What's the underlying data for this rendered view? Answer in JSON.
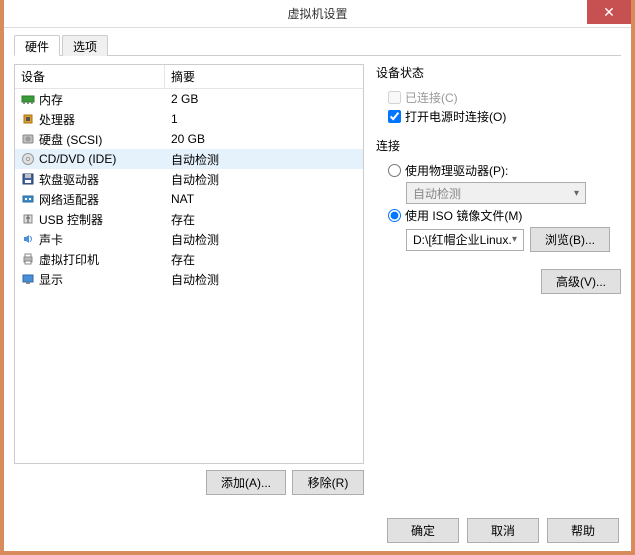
{
  "window": {
    "title": "虚拟机设置",
    "close_glyph": "✕"
  },
  "tabs": {
    "hardware": "硬件",
    "options": "选项"
  },
  "hw_table": {
    "head_device": "设备",
    "head_summary": "摘要",
    "rows": [
      {
        "device": "内存",
        "summary": "2 GB",
        "icon": "memory"
      },
      {
        "device": "处理器",
        "summary": "1",
        "icon": "cpu"
      },
      {
        "device": "硬盘 (SCSI)",
        "summary": "20 GB",
        "icon": "disk"
      },
      {
        "device": "CD/DVD (IDE)",
        "summary": "自动检测",
        "icon": "cd",
        "selected": true
      },
      {
        "device": "软盘驱动器",
        "summary": "自动检测",
        "icon": "floppy"
      },
      {
        "device": "网络适配器",
        "summary": "NAT",
        "icon": "net"
      },
      {
        "device": "USB 控制器",
        "summary": "存在",
        "icon": "usb"
      },
      {
        "device": "声卡",
        "summary": "自动检测",
        "icon": "sound"
      },
      {
        "device": "虚拟打印机",
        "summary": "存在",
        "icon": "printer"
      },
      {
        "device": "显示",
        "summary": "自动检测",
        "icon": "display"
      }
    ]
  },
  "left_buttons": {
    "add": "添加(A)...",
    "remove": "移除(R)"
  },
  "status_group": {
    "title": "设备状态",
    "connected": "已连接(C)",
    "power_on": "打开电源时连接(O)"
  },
  "conn_group": {
    "title": "连接",
    "physical": "使用物理驱动器(P):",
    "physical_value": "自动检测",
    "iso": "使用 ISO 镜像文件(M)",
    "iso_value": "D:\\[红帽企业Linux.",
    "browse": "浏览(B)..."
  },
  "adv_button": "高级(V)...",
  "footer": {
    "ok": "确定",
    "cancel": "取消",
    "help": "帮助"
  }
}
